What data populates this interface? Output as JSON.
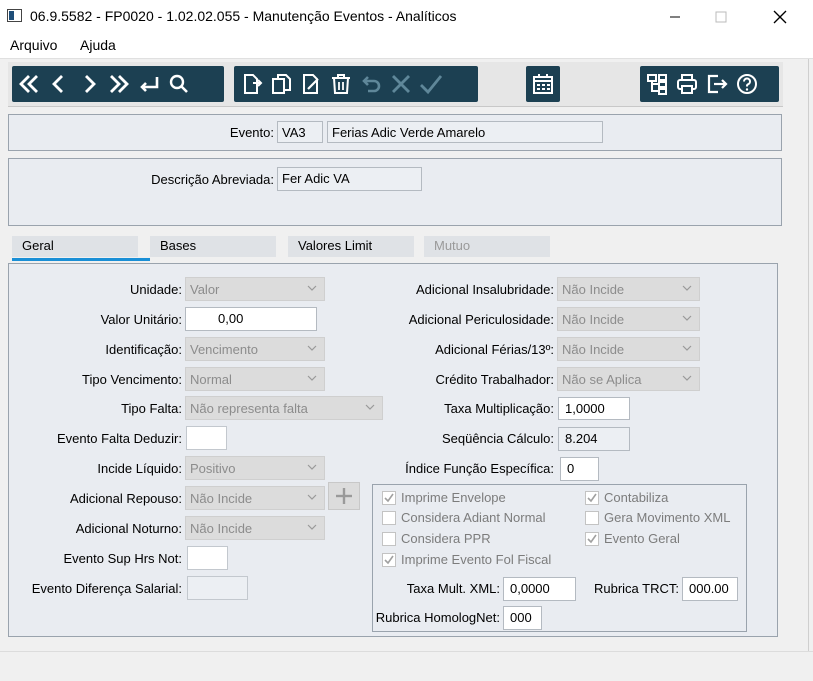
{
  "window": {
    "title": "06.9.5582 - FP0020 - 1.02.02.055 - Manutenção Eventos - Analíticos"
  },
  "menu": {
    "items": [
      "Arquivo",
      "Ajuda"
    ]
  },
  "toolbar": {
    "nav_icons": [
      "first-icon",
      "previous-icon",
      "next-icon",
      "last-icon",
      "return-icon",
      "search-icon"
    ],
    "edit_icons": [
      "new-icon",
      "copy-icon",
      "edit-icon",
      "delete-icon",
      "undo-icon",
      "cancel-icon",
      "confirm-icon"
    ],
    "calendar_icon": "calendar-icon",
    "right_icons": [
      "hierarchy-icon",
      "print-icon",
      "exit-icon",
      "help-icon"
    ],
    "bg_color": "#1c4052"
  },
  "header": {
    "evento_label": "Evento:",
    "evento_code": "VA3",
    "evento_desc": "Ferias Adic Verde Amarelo",
    "desc_abrev_label": "Descrição Abreviada:",
    "desc_abrev_value": "Fer Adic VA"
  },
  "tabs": [
    {
      "label": "Geral",
      "active": true
    },
    {
      "label": "Bases",
      "active": false
    },
    {
      "label": "Valores Limit",
      "active": false
    },
    {
      "label": "Mutuo",
      "active": false,
      "disabled": true
    }
  ],
  "accent_color": "#1a8fd6",
  "left_fields": {
    "unidade": {
      "label": "Unidade:",
      "value": "Valor"
    },
    "valor_unitario": {
      "label": "Valor Unitário:",
      "value": "0,00"
    },
    "identificacao": {
      "label": "Identificação:",
      "value": "Vencimento"
    },
    "tipo_vencimento": {
      "label": "Tipo Vencimento:",
      "value": "Normal"
    },
    "tipo_falta": {
      "label": "Tipo Falta:",
      "value": "Não representa falta"
    },
    "evento_falta_deduzir": {
      "label": "Evento Falta Deduzir:",
      "value": ""
    },
    "incide_liquido": {
      "label": "Incide Líquido:",
      "value": "Positivo"
    },
    "adicional_repouso": {
      "label": "Adicional Repouso:",
      "value": "Não Incide"
    },
    "adicional_noturno": {
      "label": "Adicional Noturno:",
      "value": "Não Incide"
    },
    "evento_sup_hrs_not": {
      "label": "Evento Sup Hrs Not:",
      "value": ""
    },
    "evento_diferenca_salarial": {
      "label": "Evento Diferença Salarial:",
      "value": ""
    }
  },
  "right_fields": {
    "adicional_insalubridade": {
      "label": "Adicional Insalubridade:",
      "value": "Não Incide"
    },
    "adicional_periculosidade": {
      "label": "Adicional Periculosidade:",
      "value": "Não Incide"
    },
    "adicional_ferias": {
      "label": "Adicional Férias/13º:",
      "value": "Não Incide"
    },
    "credito_trabalhador": {
      "label": "Crédito Trabalhador:",
      "value": "Não se Aplica"
    },
    "taxa_multiplicacao": {
      "label": "Taxa Multiplicação:",
      "value": "1,0000"
    },
    "sequencia_calculo": {
      "label": "Seqüência Cálculo:",
      "value": "8.204"
    },
    "indice_funcao": {
      "label": "Índice Função Específica:",
      "value": "0"
    }
  },
  "checkboxes": [
    {
      "label": "Imprime Envelope",
      "checked": true
    },
    {
      "label": "Contabiliza",
      "checked": true
    },
    {
      "label": "Considera Adiant Normal",
      "checked": false
    },
    {
      "label": "Gera Movimento XML",
      "checked": false
    },
    {
      "label": "Considera PPR",
      "checked": false
    },
    {
      "label": "Evento Geral",
      "checked": true
    },
    {
      "label": "Imprime Evento Fol Fiscal",
      "checked": true
    }
  ],
  "group_fields": {
    "taxa_mult_xml": {
      "label": "Taxa Mult. XML:",
      "value": "0,0000"
    },
    "rubrica_trct": {
      "label": "Rubrica TRCT:",
      "value": "000.00"
    },
    "rubrica_homolognet": {
      "label": "Rubrica HomologNet:",
      "value": "000"
    }
  }
}
